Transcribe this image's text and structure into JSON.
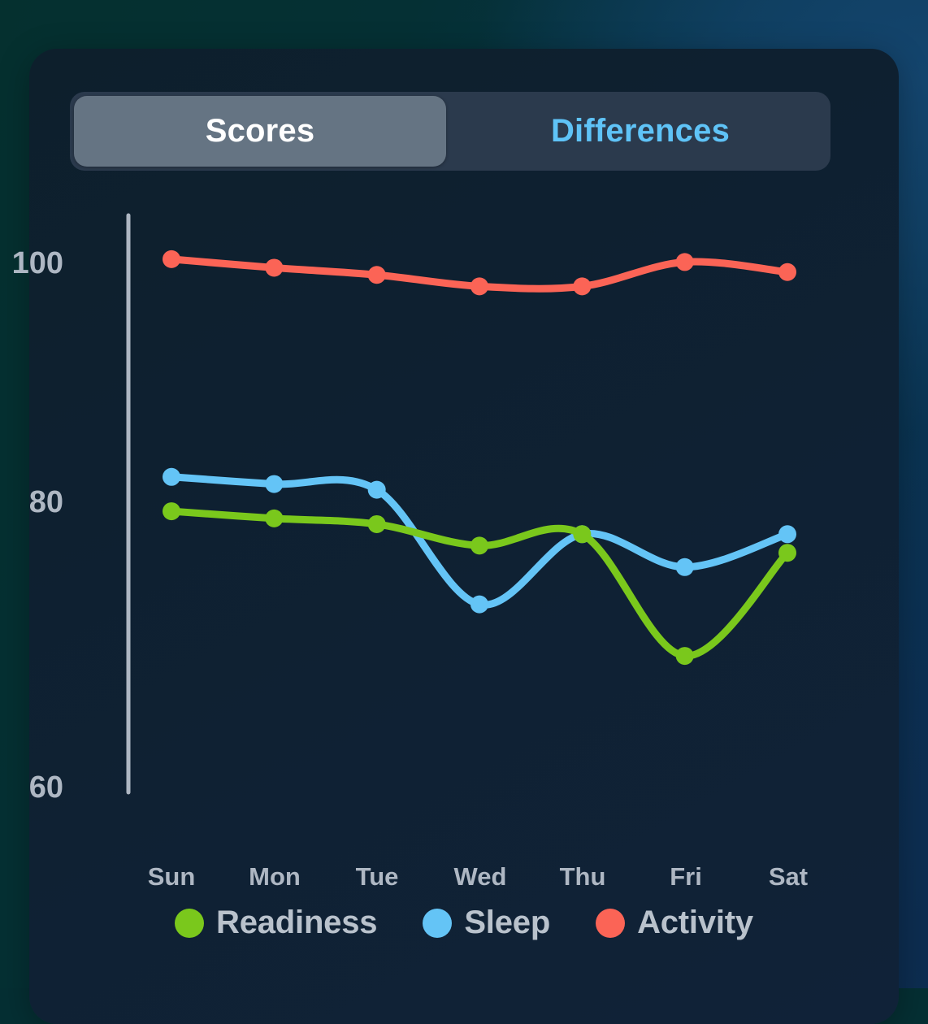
{
  "tabs": {
    "items": [
      {
        "label": "Scores",
        "active": true
      },
      {
        "label": "Differences",
        "active": false
      }
    ]
  },
  "colors": {
    "readiness": "#7ac81c",
    "sleep": "#64c4f6",
    "activity": "#fb6456",
    "axis": "#aeb7c3",
    "tick_text": "#aeb7c3",
    "card_bg": "#0f2133",
    "segment_track": "#2b3a4d",
    "segment_active_bg": "#657483",
    "segment_active_text": "#ffffff",
    "segment_inactive_text": "#5fc3f7",
    "legend_text": "#b9c2cc"
  },
  "legend": {
    "items": [
      {
        "label": "Readiness",
        "color": "#7ac81c"
      },
      {
        "label": "Sleep",
        "color": "#64c4f6"
      },
      {
        "label": "Activity",
        "color": "#fb6456"
      }
    ]
  },
  "axis": {
    "y_ticks": [
      "100",
      "80",
      "60"
    ],
    "x_ticks": [
      "Sun",
      "Mon",
      "Tue",
      "Wed",
      "Thu",
      "Fri",
      "Sat"
    ]
  },
  "chart_data": {
    "type": "line",
    "title": "",
    "subtitle": "",
    "xlabel": "",
    "ylabel": "",
    "categories": [
      "Sun",
      "Mon",
      "Tue",
      "Wed",
      "Thu",
      "Fri",
      "Sat"
    ],
    "ylim": [
      60,
      100
    ],
    "y_ticks": [
      60,
      80,
      100
    ],
    "grid": false,
    "legend_position": "bottom",
    "curve": "smooth",
    "markers": true,
    "series": [
      {
        "name": "Readiness",
        "color": "#7ac81c",
        "values": [
          79.4,
          78.9,
          78.5,
          77.0,
          77.8,
          69.3,
          76.5
        ]
      },
      {
        "name": "Sleep",
        "color": "#64c4f6",
        "values": [
          81.8,
          81.3,
          80.9,
          72.9,
          77.8,
          75.5,
          77.8
        ]
      },
      {
        "name": "Activity",
        "color": "#fb6456",
        "values": [
          97.0,
          96.4,
          95.9,
          95.1,
          95.1,
          96.8,
          96.1
        ]
      }
    ]
  }
}
